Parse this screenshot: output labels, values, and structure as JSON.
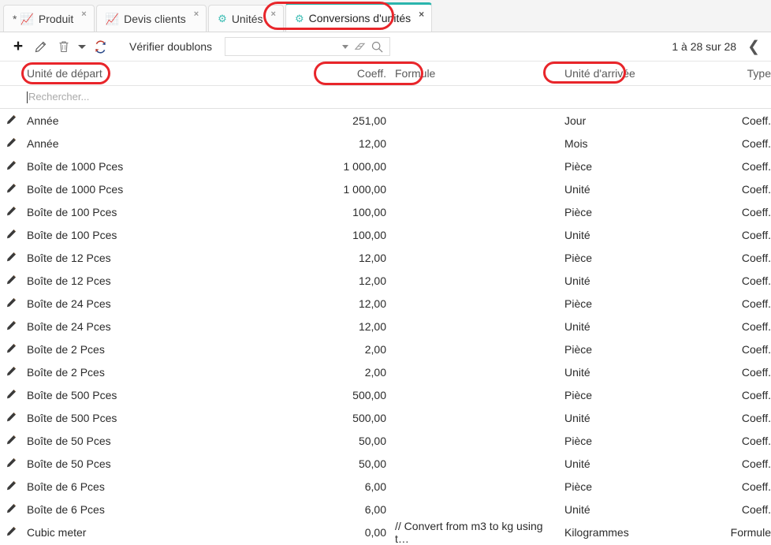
{
  "tabs": [
    {
      "dirty": "*",
      "icon": "chart-icon",
      "label": "Produit",
      "close": "×",
      "active": false
    },
    {
      "dirty": "",
      "icon": "chart-icon",
      "label": "Devis clients",
      "close": "×",
      "active": false
    },
    {
      "dirty": "",
      "icon": "gear-icon",
      "label": "Unités",
      "close": "×",
      "active": false
    },
    {
      "dirty": "",
      "icon": "gear-icon",
      "label": "Conversions d'unités",
      "close": "×",
      "active": true
    }
  ],
  "toolbar": {
    "add_label": "+",
    "edit_icon": "pencil-icon",
    "delete_icon": "trash-icon",
    "delete_caret": "chevron-down-icon",
    "refresh_icon": "refresh-icon",
    "check_duplicates_label": "Vérifier doublons",
    "filter_value": "",
    "filter_placeholder": "",
    "filter_caret_icon": "chevron-down-icon",
    "filter_erase_icon": "eraser-icon",
    "filter_search_icon": "search-icon",
    "pager_text": "1 à 28 sur 28",
    "pager_prev_icon": "chevron-left-icon"
  },
  "grid": {
    "columns": {
      "from": "Unité de départ",
      "coeff": "Coeff.",
      "formula": "Formule",
      "to": "Unité d'arrivée",
      "type": "Type"
    },
    "search_placeholder": "Rechercher...",
    "rows": [
      {
        "edit": "pencil-icon",
        "from": "Année",
        "coeff": "251,00",
        "formula": "",
        "to": "Jour",
        "type": "Coeff."
      },
      {
        "edit": "pencil-icon",
        "from": "Année",
        "coeff": "12,00",
        "formula": "",
        "to": "Mois",
        "type": "Coeff."
      },
      {
        "edit": "pencil-icon",
        "from": "Boîte de 1000 Pces",
        "coeff": "1 000,00",
        "formula": "",
        "to": "Pièce",
        "type": "Coeff."
      },
      {
        "edit": "pencil-icon",
        "from": "Boîte de 1000 Pces",
        "coeff": "1 000,00",
        "formula": "",
        "to": "Unité",
        "type": "Coeff."
      },
      {
        "edit": "pencil-icon",
        "from": "Boîte de 100 Pces",
        "coeff": "100,00",
        "formula": "",
        "to": "Pièce",
        "type": "Coeff."
      },
      {
        "edit": "pencil-icon",
        "from": "Boîte de 100 Pces",
        "coeff": "100,00",
        "formula": "",
        "to": "Unité",
        "type": "Coeff."
      },
      {
        "edit": "pencil-icon",
        "from": "Boîte de 12 Pces",
        "coeff": "12,00",
        "formula": "",
        "to": "Pièce",
        "type": "Coeff."
      },
      {
        "edit": "pencil-icon",
        "from": "Boîte de 12 Pces",
        "coeff": "12,00",
        "formula": "",
        "to": "Unité",
        "type": "Coeff."
      },
      {
        "edit": "pencil-icon",
        "from": "Boîte de 24 Pces",
        "coeff": "12,00",
        "formula": "",
        "to": "Pièce",
        "type": "Coeff."
      },
      {
        "edit": "pencil-icon",
        "from": "Boîte de 24 Pces",
        "coeff": "12,00",
        "formula": "",
        "to": "Unité",
        "type": "Coeff."
      },
      {
        "edit": "pencil-icon",
        "from": "Boîte de 2 Pces",
        "coeff": "2,00",
        "formula": "",
        "to": "Pièce",
        "type": "Coeff."
      },
      {
        "edit": "pencil-icon",
        "from": "Boîte de 2 Pces",
        "coeff": "2,00",
        "formula": "",
        "to": "Unité",
        "type": "Coeff."
      },
      {
        "edit": "pencil-icon",
        "from": "Boîte de 500 Pces",
        "coeff": "500,00",
        "formula": "",
        "to": "Pièce",
        "type": "Coeff."
      },
      {
        "edit": "pencil-icon",
        "from": "Boîte de 500 Pces",
        "coeff": "500,00",
        "formula": "",
        "to": "Unité",
        "type": "Coeff."
      },
      {
        "edit": "pencil-icon",
        "from": "Boîte de 50 Pces",
        "coeff": "50,00",
        "formula": "",
        "to": "Pièce",
        "type": "Coeff."
      },
      {
        "edit": "pencil-icon",
        "from": "Boîte de 50 Pces",
        "coeff": "50,00",
        "formula": "",
        "to": "Unité",
        "type": "Coeff."
      },
      {
        "edit": "pencil-icon",
        "from": "Boîte de 6 Pces",
        "coeff": "6,00",
        "formula": "",
        "to": "Pièce",
        "type": "Coeff."
      },
      {
        "edit": "pencil-icon",
        "from": "Boîte de 6 Pces",
        "coeff": "6,00",
        "formula": "",
        "to": "Unité",
        "type": "Coeff."
      },
      {
        "edit": "pencil-icon",
        "from": "Cubic meter",
        "coeff": "0,00",
        "formula": "// Convert from m3 to kg using t…",
        "to": "Kilogrammes",
        "type": "Formule"
      }
    ]
  },
  "annotations": {
    "color": "#e8252a",
    "highlighted": [
      "active-tab",
      "unite-de-depart-header",
      "coeff-formule-header",
      "unite-d-arrivee-header"
    ]
  }
}
